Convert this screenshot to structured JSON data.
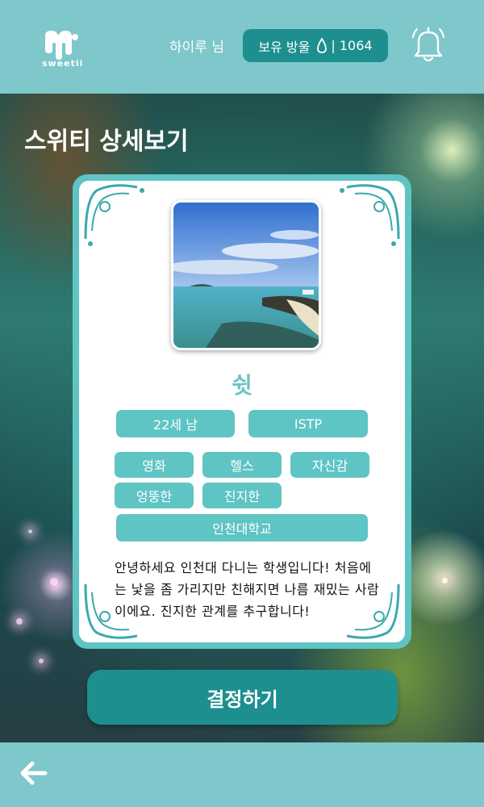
{
  "header": {
    "logo_text": "sweetii",
    "username": "하이루 님",
    "drops_label": "보유 방울",
    "drops_count": "| 1064",
    "icons": [
      "logo-icon",
      "water-drop-icon",
      "bell-icon"
    ]
  },
  "page": {
    "title": "스위티 상세보기"
  },
  "profile": {
    "nickname": "쉿",
    "age_gender": "22세 남",
    "mbti": "ISTP",
    "interests": [
      "영화",
      "헬스",
      "자신감"
    ],
    "traits": [
      "엉뚱한",
      "진지한"
    ],
    "school": "인천대학교",
    "intro": "안녕하세요 인천대 다니는 학생입니다! 처음에는 낯을 좀 가리지만 친해지면 나름 재밌는 사람이에요. 진지한 관계를 추구합니다!"
  },
  "actions": {
    "decide_label": "결정하기"
  },
  "footer": {
    "back_icon": "arrow-left-icon"
  },
  "colors": {
    "header_bg": "#7ec7cb",
    "accent_dark": "#1e8f8f",
    "tag_bg": "#5fc4c4",
    "nickname": "#6ec3c3"
  }
}
